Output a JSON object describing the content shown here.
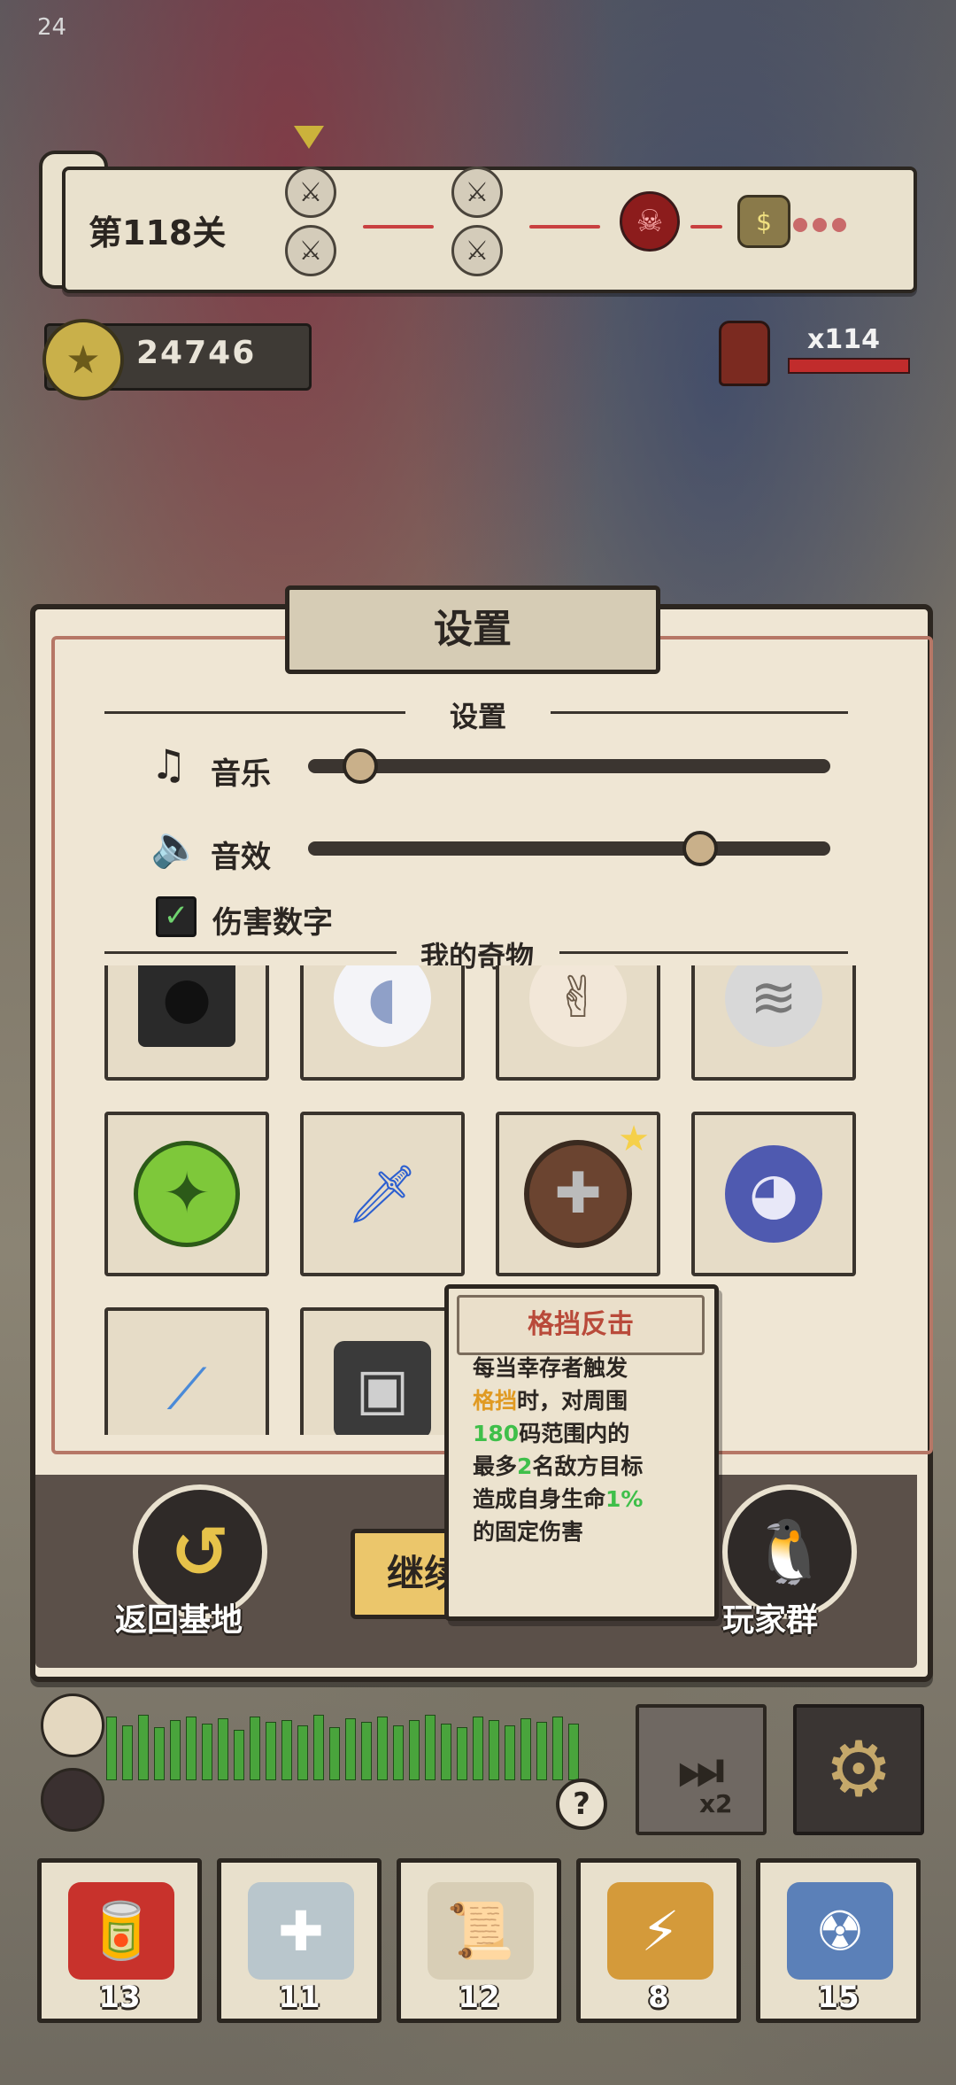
{
  "status_bar": {
    "time": "24"
  },
  "level": {
    "label": "第118关"
  },
  "coins": {
    "amount": "24746"
  },
  "enemy": {
    "count": "x114"
  },
  "settings_panel": {
    "title": "设置",
    "section_settings": "设置",
    "music_label": "音乐",
    "sound_label": "音效",
    "music_level": 0.1,
    "sound_level": 0.75,
    "damage_numbers_label": "伤害数字",
    "damage_numbers_checked": true,
    "section_relics": "我的奇物",
    "relics": [
      {
        "icon": "shadow-figure-icon"
      },
      {
        "icon": "milk-bottle-icon"
      },
      {
        "icon": "crossed-fingers-icon"
      },
      {
        "icon": "gray-hair-icon"
      },
      {
        "icon": "green-emblem-icon"
      },
      {
        "icon": "blue-sword-icon"
      },
      {
        "icon": "spiked-shield-icon",
        "starred": true
      },
      {
        "icon": "pigeon-icon"
      },
      {
        "icon": "ice-blade-icon"
      },
      {
        "icon": "backpack-icon"
      }
    ]
  },
  "tooltip": {
    "title": "格挡反击",
    "line1": "每当幸存者触发",
    "line2_hl": "格挡",
    "line2_rest": "时，对周围",
    "line3_hl": "180",
    "line3_rest": "码范围内的",
    "line4_a": "最多",
    "line4_hl": "2",
    "line4_rest": "名敌方目标",
    "line5_a": "造成自身生命",
    "line5_hl": "1%",
    "line6": "的固定伤害"
  },
  "buttons": {
    "back_to_base": "返回基地",
    "continue": "继续",
    "player_group": "玩家群",
    "speed_label": "x2"
  },
  "items": [
    {
      "icon": "cola-can-icon",
      "count": "13",
      "color": "#c8322c"
    },
    {
      "icon": "medkit-icon",
      "count": "11",
      "color": "#b9c6cc"
    },
    {
      "icon": "scroll-icon",
      "count": "12",
      "color": "#d8ceb6"
    },
    {
      "icon": "lightning-paper-icon",
      "count": "8",
      "color": "#d49a3a"
    },
    {
      "icon": "nuke-canister-icon",
      "count": "15",
      "color": "#5b80b8"
    }
  ]
}
